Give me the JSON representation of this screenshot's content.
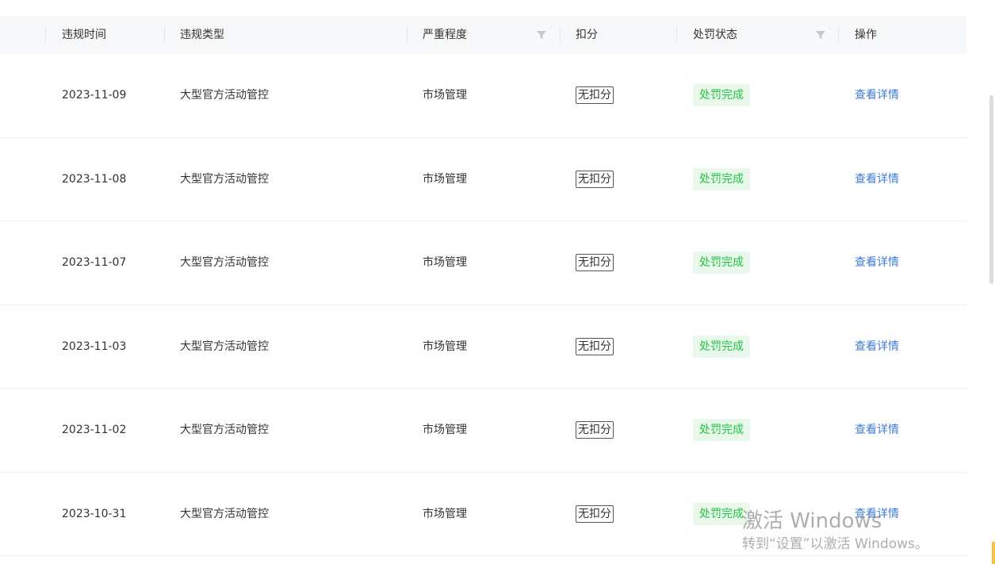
{
  "table": {
    "columns": {
      "time": "违规时间",
      "type": "违规类型",
      "severity": "严重程度",
      "deduction": "扣分",
      "status": "处罚状态",
      "action": "操作"
    },
    "rows": [
      {
        "time": "2023-11-09",
        "type": "大型官方活动管控",
        "severity": "市场管理",
        "deduction": "无扣分",
        "status": "处罚完成",
        "action": "查看详情"
      },
      {
        "time": "2023-11-08",
        "type": "大型官方活动管控",
        "severity": "市场管理",
        "deduction": "无扣分",
        "status": "处罚完成",
        "action": "查看详情"
      },
      {
        "time": "2023-11-07",
        "type": "大型官方活动管控",
        "severity": "市场管理",
        "deduction": "无扣分",
        "status": "处罚完成",
        "action": "查看详情"
      },
      {
        "time": "2023-11-03",
        "type": "大型官方活动管控",
        "severity": "市场管理",
        "deduction": "无扣分",
        "status": "处罚完成",
        "action": "查看详情"
      },
      {
        "time": "2023-11-02",
        "type": "大型官方活动管控",
        "severity": "市场管理",
        "deduction": "无扣分",
        "status": "处罚完成",
        "action": "查看详情"
      },
      {
        "time": "2023-10-31",
        "type": "大型官方活动管控",
        "severity": "市场管理",
        "deduction": "无扣分",
        "status": "处罚完成",
        "action": "查看详情"
      }
    ]
  },
  "colors": {
    "header_bg": "#f7f8fa",
    "status_text": "#23c343",
    "status_bg": "#e8f8ea",
    "link": "#3d7bd9",
    "divider": "#eceef2"
  },
  "icons": {
    "severity_filter": "filter-icon",
    "status_filter": "filter-icon"
  },
  "watermark": {
    "line1": "激活 Windows",
    "line2": "转到“设置”以激活 Windows。"
  }
}
